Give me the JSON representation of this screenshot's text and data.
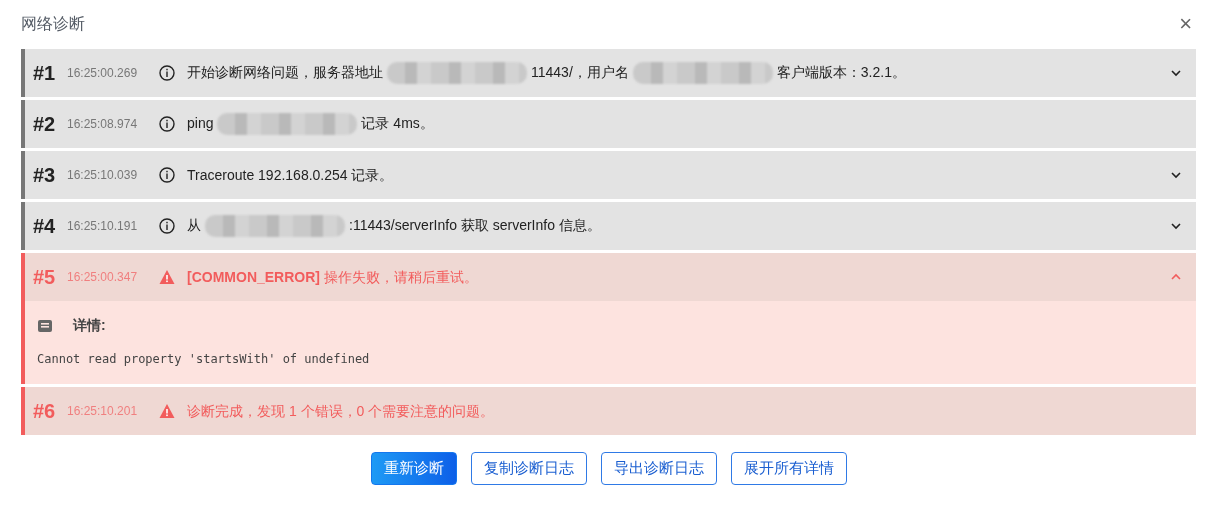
{
  "dialog": {
    "title": "网络诊断",
    "close": "×"
  },
  "entries": [
    {
      "number": "#1",
      "time": "16:25:00.269",
      "kind": "info",
      "expanded": false,
      "message": [
        {
          "kind": "text",
          "text": "开始诊断网络问题，服务器地址"
        },
        {
          "kind": "redacted"
        },
        {
          "kind": "text",
          "text": "11443/，用户名"
        },
        {
          "kind": "redacted"
        },
        {
          "kind": "text",
          "text": "客户端版本：3.2.1。"
        }
      ]
    },
    {
      "number": "#2",
      "time": "16:25:08.974",
      "kind": "info",
      "message": [
        {
          "kind": "text",
          "text": "ping"
        },
        {
          "kind": "redacted"
        },
        {
          "kind": "text",
          "text": "记录 4ms。"
        }
      ]
    },
    {
      "number": "#3",
      "time": "16:25:10.039",
      "kind": "info",
      "expanded": false,
      "message": [
        {
          "kind": "text",
          "text": "Traceroute 192.168.0.254 记录。"
        }
      ]
    },
    {
      "number": "#4",
      "time": "16:25:10.191",
      "kind": "info",
      "expanded": false,
      "message": [
        {
          "kind": "text",
          "text": "从"
        },
        {
          "kind": "redacted"
        },
        {
          "kind": "text",
          "text": ":11443/serverInfo 获取 serverInfo 信息。"
        }
      ]
    },
    {
      "number": "#5",
      "time": "16:25:00.347",
      "kind": "error",
      "expanded": true,
      "message": [
        {
          "kind": "text",
          "text": "**[COMMON_ERROR]** 操作失败，请稍后重试。"
        }
      ],
      "details": {
        "label": "详情:",
        "text": "Cannot read property 'startsWith' of undefined"
      }
    },
    {
      "number": "#6",
      "time": "16:25:10.201",
      "kind": "error",
      "message": [
        {
          "kind": "text",
          "text": "诊断完成，发现 1 个错误，0 个需要注意的问题。"
        }
      ]
    }
  ],
  "buttons": [
    {
      "label": "重新诊断",
      "kind": "primary"
    },
    {
      "label": "复制诊断日志",
      "kind": "outline"
    },
    {
      "label": "导出诊断日志",
      "kind": "outline"
    },
    {
      "label": "展开所有详情",
      "kind": "outline"
    }
  ]
}
